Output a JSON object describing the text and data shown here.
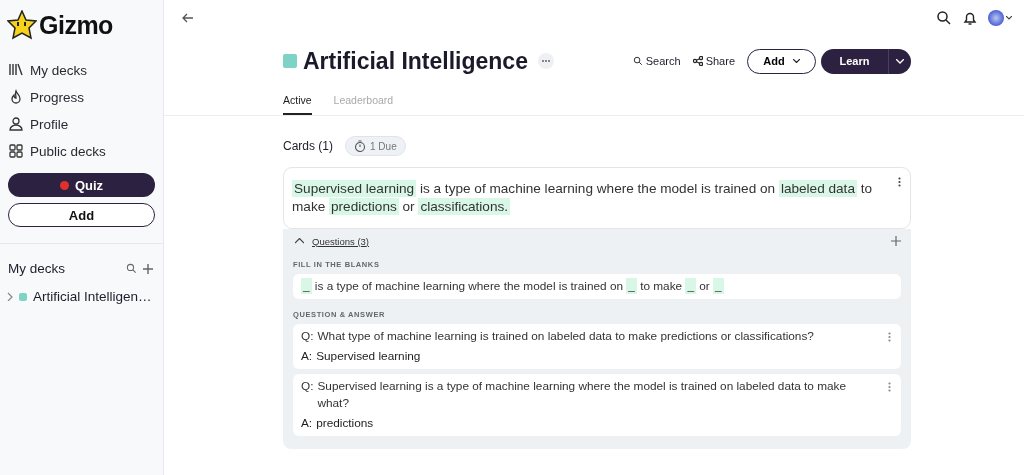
{
  "sidebar": {
    "logo": "Gizmo",
    "nav": [
      {
        "label": "My decks"
      },
      {
        "label": "Progress"
      },
      {
        "label": "Profile"
      },
      {
        "label": "Public decks"
      }
    ],
    "quiz_button": "Quiz",
    "add_button": "Add",
    "decks_heading": "My decks",
    "decks": [
      {
        "label": "Artificial Intelligen…",
        "color": "#7fd3c6",
        "expanded": false
      }
    ]
  },
  "deck": {
    "title": "Artificial Intelligence",
    "color": "#7fd3c6",
    "search": "Search",
    "share": "Share",
    "add": "Add",
    "learn": "Learn",
    "tabs": [
      {
        "label": "Active",
        "selected": true
      },
      {
        "label": "Leaderboard",
        "selected": false
      }
    ],
    "cards_count": "Cards (1)",
    "due": "1 Due"
  },
  "card": {
    "segments": [
      {
        "text": "Supervised learning",
        "highlight": true
      },
      {
        "text": " is a type of machine learning where the model is trained on ",
        "highlight": false
      },
      {
        "text": "labeled data",
        "highlight": true
      },
      {
        "text": " to make ",
        "highlight": false
      },
      {
        "text": "predictions",
        "highlight": true
      },
      {
        "text": " or ",
        "highlight": false
      },
      {
        "text": "classifications.",
        "highlight": true
      }
    ],
    "questions_label": "Questions (3)",
    "questions_expanded": true,
    "fill_heading": "FILL IN THE BLANKS",
    "fill_segments": [
      {
        "text": "_",
        "highlight": true
      },
      {
        "text": " is a type of machine learning where the model is trained on ",
        "highlight": false
      },
      {
        "text": "_",
        "highlight": true
      },
      {
        "text": " to make ",
        "highlight": false
      },
      {
        "text": "_",
        "highlight": true
      },
      {
        "text": " or ",
        "highlight": false
      },
      {
        "text": "_",
        "highlight": true
      }
    ],
    "qa_heading": "QUESTION & ANSWER",
    "qa": [
      {
        "q_label": "Q:",
        "question": "What type of machine learning is trained on labeled data to make predictions or classifications?",
        "a_label": "A:",
        "answer": "Supervised learning"
      },
      {
        "q_label": "Q:",
        "question": "Supervised learning is a type of machine learning where the model is trained on labeled data to make what?",
        "a_label": "A:",
        "answer": "predictions"
      }
    ]
  }
}
